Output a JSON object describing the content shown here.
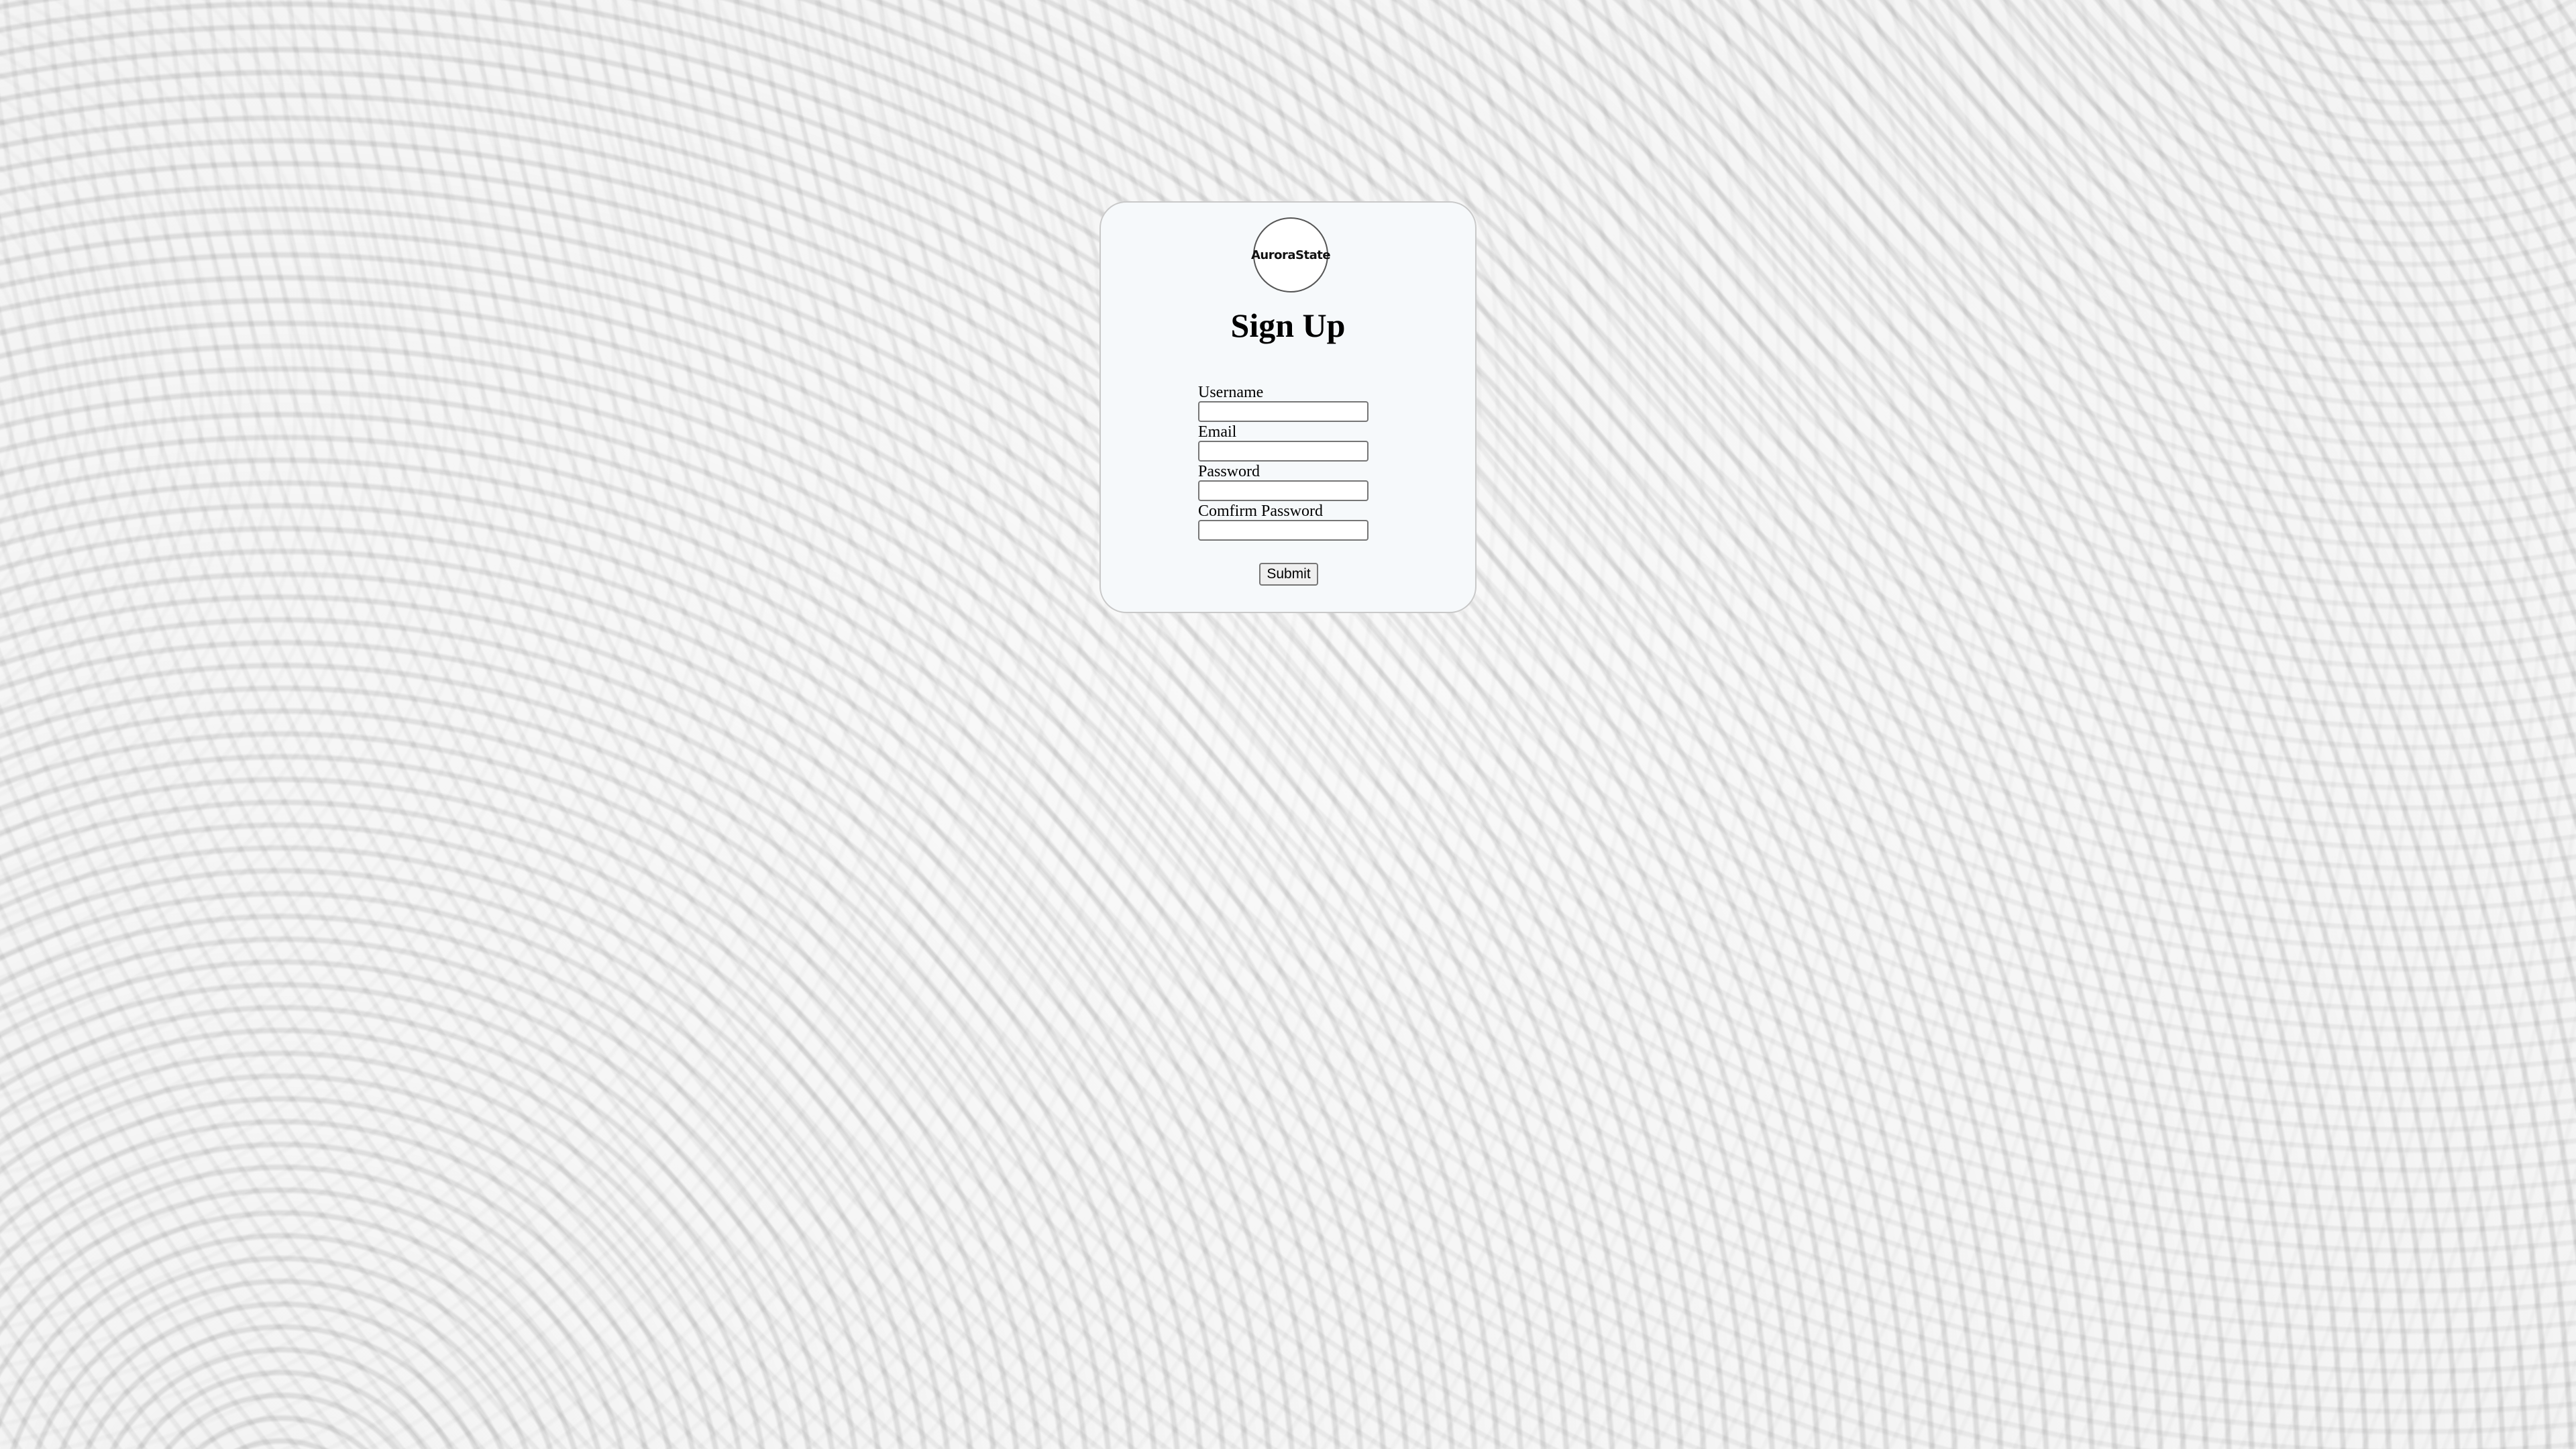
{
  "logo": {
    "text": "AuroraState"
  },
  "title": "Sign Up",
  "form": {
    "fields": [
      {
        "label": "Username",
        "value": ""
      },
      {
        "label": "Email",
        "value": ""
      },
      {
        "label": "Password",
        "value": ""
      },
      {
        "label": "Comfirm Password",
        "value": ""
      }
    ],
    "submit_label": "Submit"
  },
  "colors": {
    "card_background": "#f6f9fb",
    "page_background": "#ececec"
  }
}
